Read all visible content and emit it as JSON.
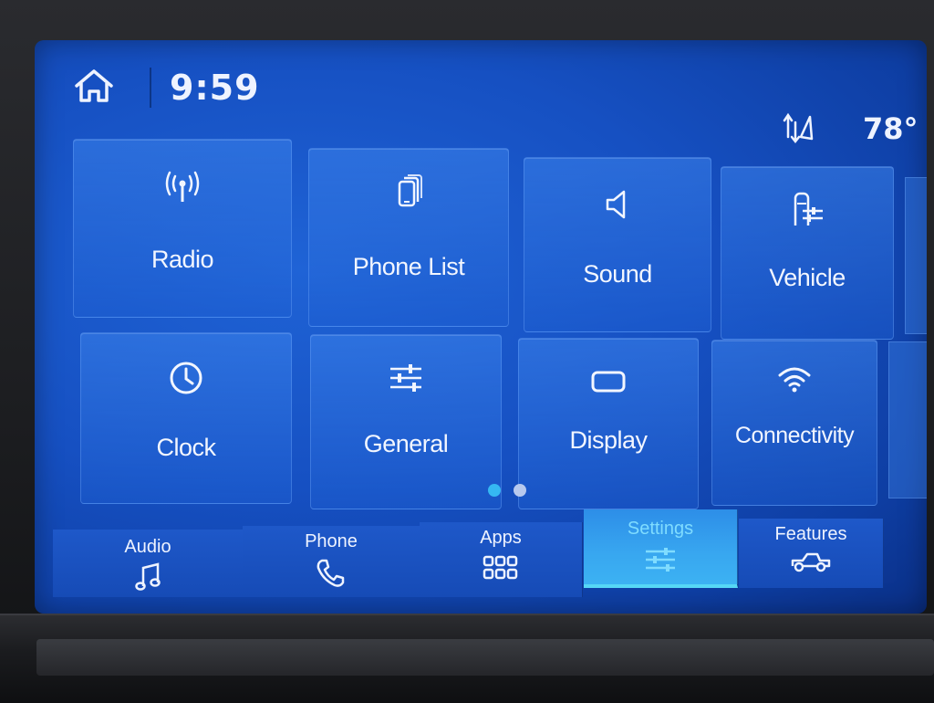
{
  "status": {
    "time": "9:59",
    "temperature": "78°"
  },
  "tiles": [
    {
      "label": "Radio",
      "icon": "radio-antenna-icon"
    },
    {
      "label": "Phone List",
      "icon": "phone-list-icon"
    },
    {
      "label": "Sound",
      "icon": "speaker-icon"
    },
    {
      "label": "Vehicle",
      "icon": "vehicle-settings-icon"
    },
    {
      "label": "Clock",
      "icon": "clock-icon"
    },
    {
      "label": "General",
      "icon": "sliders-icon"
    },
    {
      "label": "Display",
      "icon": "display-icon"
    },
    {
      "label": "Connectivity",
      "icon": "wifi-icon"
    }
  ],
  "pager": {
    "pages": 2,
    "current": 1,
    "active_color": "#35b8f2"
  },
  "bottom_nav": [
    {
      "label": "Audio",
      "icon": "music-note-icon",
      "selected": false
    },
    {
      "label": "Phone",
      "icon": "phone-handset-icon",
      "selected": false
    },
    {
      "label": "Apps",
      "icon": "apps-grid-icon",
      "selected": false
    },
    {
      "label": "Settings",
      "icon": "sliders-icon",
      "selected": true
    },
    {
      "label": "Features",
      "icon": "truck-icon",
      "selected": false
    }
  ],
  "colors": {
    "screen_blue": "#1650c2",
    "selected_tab": "#38a7f0",
    "text": "#eef3ff"
  }
}
